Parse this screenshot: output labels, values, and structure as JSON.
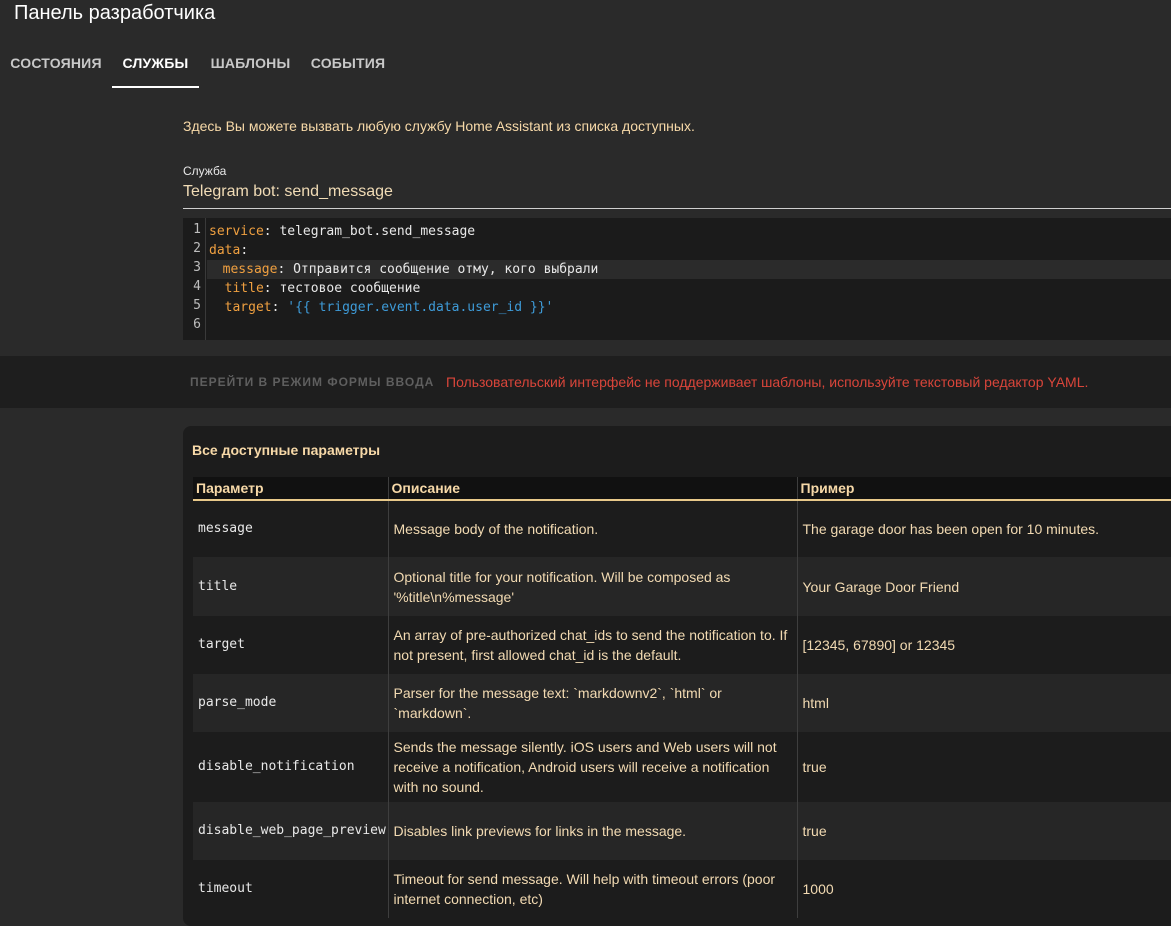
{
  "header": {
    "title": "Панель разработчика",
    "tabs": [
      "СОСТОЯНИЯ",
      "СЛУЖБЫ",
      "ШАБЛОНЫ",
      "СОБЫТИЯ"
    ]
  },
  "intro": "Здесь Вы можете вызвать любую службу Home Assistant из списка доступных.",
  "service": {
    "label": "Служба",
    "value": "Telegram bot: send_message"
  },
  "editor": {
    "line_numbers": [
      "1",
      "2",
      "3",
      "4",
      "5",
      "6"
    ],
    "lines": [
      {
        "key": "service",
        "sep": ": ",
        "val": "telegram_bot.send_message"
      },
      {
        "key": "data",
        "sep": ":",
        "val": ""
      },
      {
        "key": "message",
        "sep": ": ",
        "val": "Отправится сообщение отму, кого выбрали"
      },
      {
        "key": "title",
        "sep": ": ",
        "val": "тестовое сообщение"
      },
      {
        "key": "target",
        "sep": ": ",
        "val": "'{{ trigger.event.data.user_id }}'"
      }
    ]
  },
  "actions": {
    "form_mode_button": "ПЕРЕЙТИ В РЕЖИМ ФОРМЫ ВВОДА",
    "error": "Пользовательский интерфейс не поддерживает шаблоны, используйте текстовый редактор YAML."
  },
  "params": {
    "title": "Все доступные параметры",
    "columns": [
      "Параметр",
      "Описание",
      "Пример"
    ],
    "rows": [
      {
        "name": "message",
        "desc": "Message body of the notification.",
        "example": "The garage door has been open for 10 minutes."
      },
      {
        "name": "title",
        "desc": "Optional title for your notification. Will be composed as '%title\\n%message'",
        "example": "Your Garage Door Friend"
      },
      {
        "name": "target",
        "desc": "An array of pre-authorized chat_ids to send the notification to. If not present, first allowed chat_id is the default.",
        "example": "[12345, 67890] or 12345"
      },
      {
        "name": "parse_mode",
        "desc": "Parser for the message text: `markdownv2`, `html` or `markdown`.",
        "example": "html"
      },
      {
        "name": "disable_notification",
        "desc": "Sends the message silently. iOS users and Web users will not receive a notification, Android users will receive a notification with no sound.",
        "example": "true"
      },
      {
        "name": "disable_web_page_preview",
        "desc": "Disables link previews for links in the message.",
        "example": "true"
      },
      {
        "name": "timeout",
        "desc": "Timeout for send message. Will help with timeout errors (poor internet connection, etc)",
        "example": "1000"
      }
    ]
  },
  "colors": {
    "accent_text": "#f7d9a8",
    "error": "#d9453a",
    "yaml_key": "#f0a040",
    "yaml_template": "#3e9bd8"
  }
}
